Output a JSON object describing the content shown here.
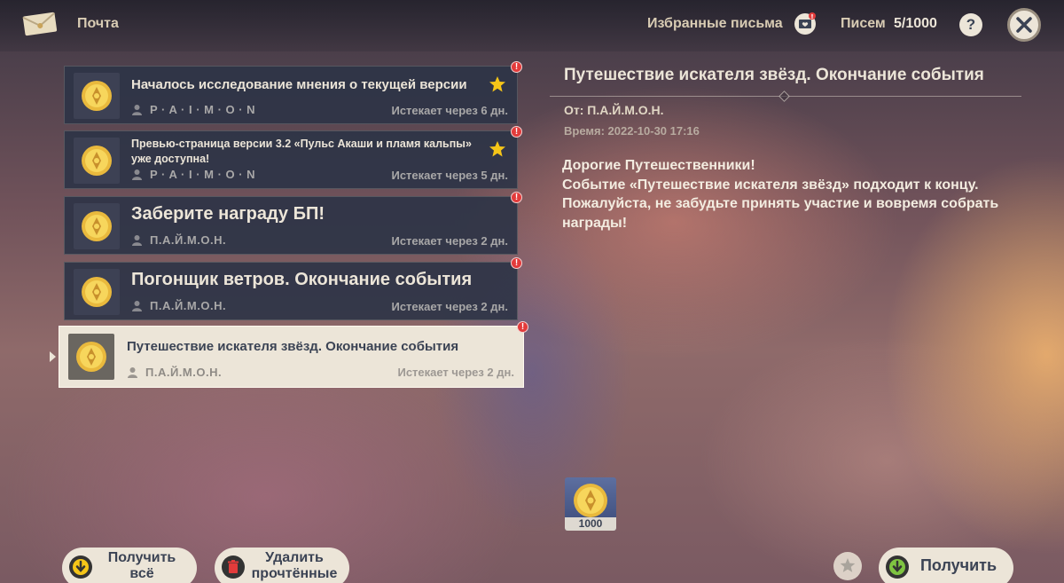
{
  "header": {
    "title": "Почта",
    "favorites_label": "Избранные письма",
    "count_label": "Писем",
    "count_value": "5/1000",
    "help_label": "?"
  },
  "mails": [
    {
      "subject": "Началось исследование мнения о текущей версии",
      "sender": "P · A · I · M · O · N",
      "expires": "Истекает через 6 дн.",
      "starred": true,
      "unread": true
    },
    {
      "subject": "Превью-страница версии 3.2 «Пульс Акаши и пламя кальпы» уже доступна!",
      "sender": "P · A · I · M · O · N",
      "expires": "Истекает через 5 дн.",
      "starred": true,
      "unread": true
    },
    {
      "subject": "Заберите награду БП!",
      "sender": "П.А.Й.М.О.Н.",
      "expires": "Истекает через 2 дн.",
      "starred": false,
      "unread": true
    },
    {
      "subject": "Погонщик ветров. Окончание события",
      "sender": "П.А.Й.М.О.Н.",
      "expires": "Истекает через 2 дн.",
      "starred": false,
      "unread": true
    },
    {
      "subject": "Путешествие искателя звёзд. Окончание события",
      "sender": "П.А.Й.М.О.Н.",
      "expires": "Истекает через 2 дн.",
      "starred": false,
      "unread": true,
      "selected": true
    }
  ],
  "detail": {
    "title": "Путешествие искателя звёзд. Окончание события",
    "from": "От: П.А.Й.М.О.Н.",
    "time": "Время: 2022-10-30 17:16",
    "body_line1": "Дорогие Путешественники!",
    "body_line2": "Событие «Путешествие искателя звёзд» подходит к концу. Пожалуйста, не забудьте принять участие и вовремя собрать награды!",
    "attachment_count": "1000"
  },
  "buttons": {
    "claim_all": "Получить всё",
    "delete_read": "Удалить прочтённые",
    "claim": "Получить"
  },
  "colors": {
    "panel_dark": "#2e3446",
    "panel_light": "#ece5d8",
    "text_dark": "#3b4354",
    "badge_red": "#e23b3b",
    "star_gold": "#f5c518"
  }
}
